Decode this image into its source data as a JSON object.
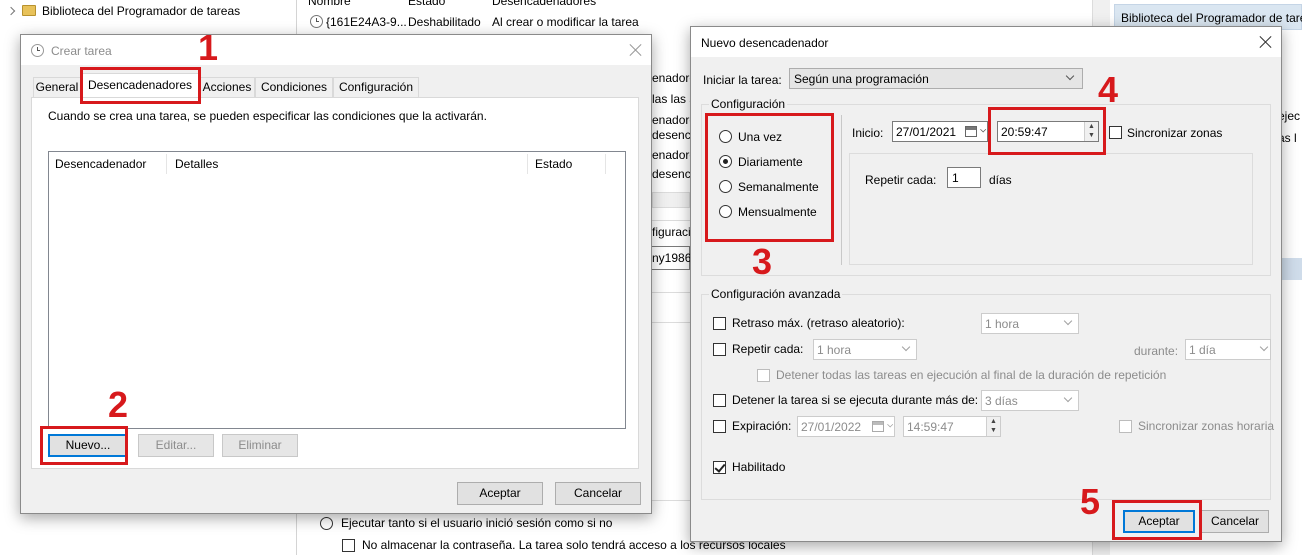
{
  "background": {
    "tree_item": "Biblioteca del Programador de tareas",
    "columns": [
      "Nombre",
      "Estado",
      "Desencadenadores"
    ],
    "row": {
      "name": "{161E24A3-9...",
      "status": "Deshabilitado",
      "trigger": "Al crear o modificar la tarea"
    },
    "snippets": [
      "enadore",
      "las las se",
      "enadore",
      "desenca",
      "enadore",
      "desenc",
      "enadore",
      "desenc"
    ],
    "config_partial": "figuracio",
    "user_partial": "ny1986@",
    "right_panel_title": "Biblioteca del Programador de tare",
    "right_snippets": [
      "ejec",
      "as l"
    ],
    "bottom_radio": "Ejecutar tanto si el usuario inició sesión como si no",
    "bottom_checkbox": "No almacenar la contraseña. La tarea solo tendrá acceso a los recursos locales"
  },
  "crear_tarea": {
    "title": "Crear tarea",
    "tabs": [
      "General",
      "Desencadenadores",
      "Acciones",
      "Condiciones",
      "Configuración"
    ],
    "active_tab": "Desencadenadores",
    "description": "Cuando se crea una tarea, se pueden especificar las condiciones que la activarán.",
    "table_headers": [
      "Desencadenador",
      "Detalles",
      "Estado"
    ],
    "buttons": {
      "nuevo": "Nuevo...",
      "editar": "Editar...",
      "eliminar": "Eliminar"
    },
    "footer": {
      "aceptar": "Aceptar",
      "cancelar": "Cancelar"
    }
  },
  "nuevo_desencadenador": {
    "title": "Nuevo desencadenador",
    "iniciar_label": "Iniciar la tarea:",
    "iniciar_value": "Según una programación",
    "config_group": "Configuración",
    "radios": [
      "Una vez",
      "Diariamente",
      "Semanalmente",
      "Mensualmente"
    ],
    "selected_radio": "Diariamente",
    "inicio_label": "Inicio:",
    "inicio_date": "27/01/2021",
    "inicio_time": "20:59:47",
    "sync_label": "Sincronizar zonas",
    "sync_checked": false,
    "repetir_label": "Repetir cada:",
    "repetir_value": "1",
    "repetir_unit": "días",
    "advanced_group": "Configuración avanzada",
    "retraso_label": "Retraso máx. (retraso aleatorio):",
    "retraso_value": "1 hora",
    "repetir_cada_label": "Repetir cada:",
    "repetir_cada_value": "1 hora",
    "durante_label": "durante:",
    "durante_value": "1 día",
    "detener_todas_label": "Detener todas las tareas en ejecución al final de la duración de repetición",
    "detener_tarea_label": "Detener la tarea si se ejecuta durante más de:",
    "detener_tarea_value": "3 días",
    "expiracion_label": "Expiración:",
    "expiracion_date": "27/01/2022",
    "expiracion_time": "14:59:47",
    "sync_horaria_label": "Sincronizar zonas horaria",
    "habilitado_label": "Habilitado",
    "habilitado_checked": true,
    "footer": {
      "aceptar": "Aceptar",
      "cancelar": "Cancelar"
    }
  },
  "annotations": {
    "colors": {
      "red": "#d7191c"
    },
    "numbers": [
      "1",
      "2",
      "3",
      "4",
      "5"
    ]
  }
}
